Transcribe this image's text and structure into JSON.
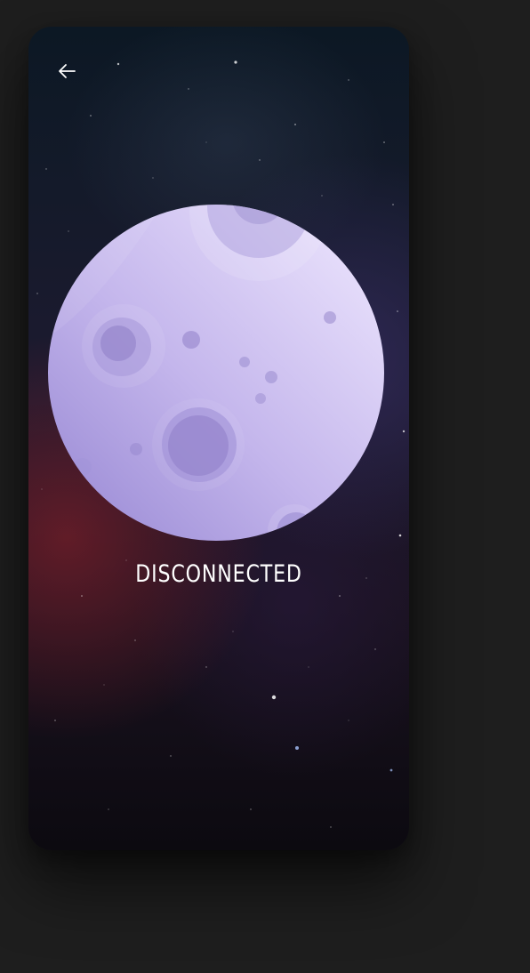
{
  "header": {
    "back_icon": "arrow-left-icon"
  },
  "main": {
    "status_text": "DISCONNECTED",
    "illustration": "moon-icon"
  },
  "colors": {
    "page_background": "#1e1e1e",
    "moon_light": "#e9e1fb",
    "moon_dark": "#9d8ed6",
    "status_text": "#ffffff"
  }
}
